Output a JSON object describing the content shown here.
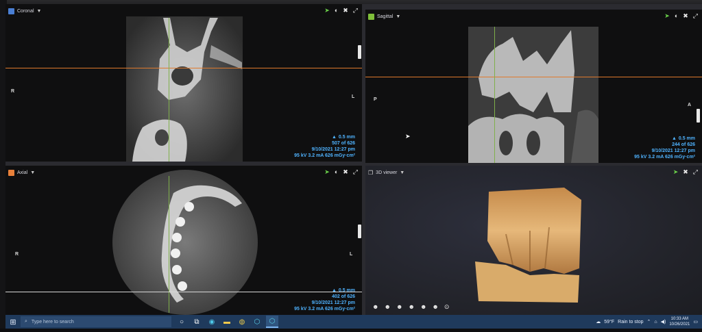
{
  "coronal": {
    "title": "Coronal",
    "swatch_color": "#4a7fd4",
    "orient_left": "R",
    "orient_right": "L",
    "thickness": "0.5 mm",
    "slice": "507 of 626",
    "datetime": "9/10/2021 12:27 pm",
    "params": "95 kV  3.2 mA  626 mGy·cm²"
  },
  "sagittal": {
    "title": "Sagittal",
    "swatch_color": "#7fbf3a",
    "orient_left": "P",
    "orient_right": "A",
    "thickness": "0.5 mm",
    "slice": "244 of 626",
    "datetime": "9/10/2021 12:27 pm",
    "params": "95 kV  3.2 mA  626 mGy·cm²"
  },
  "axial": {
    "title": "Axial",
    "swatch_color": "#e8803a",
    "orient_left": "R",
    "orient_right": "L",
    "thickness": "0.5 mm",
    "slice": "402 of 626",
    "datetime": "9/10/2021 12:27 pm",
    "params": "95 kV  3.2 mA  626 mGy·cm²"
  },
  "viewer3d": {
    "title": "3D viewer"
  },
  "taskbar": {
    "search_placeholder": "Type here to search",
    "weather": "59°F",
    "weather_text": "Rain to stop",
    "time": "10:33 AM",
    "date": "10/26/2021"
  },
  "icons": {
    "pointer": "pointer-tool-icon",
    "contrast": "contrast-icon",
    "crosshair": "crosshair-icon",
    "expand": "expand-icon"
  }
}
